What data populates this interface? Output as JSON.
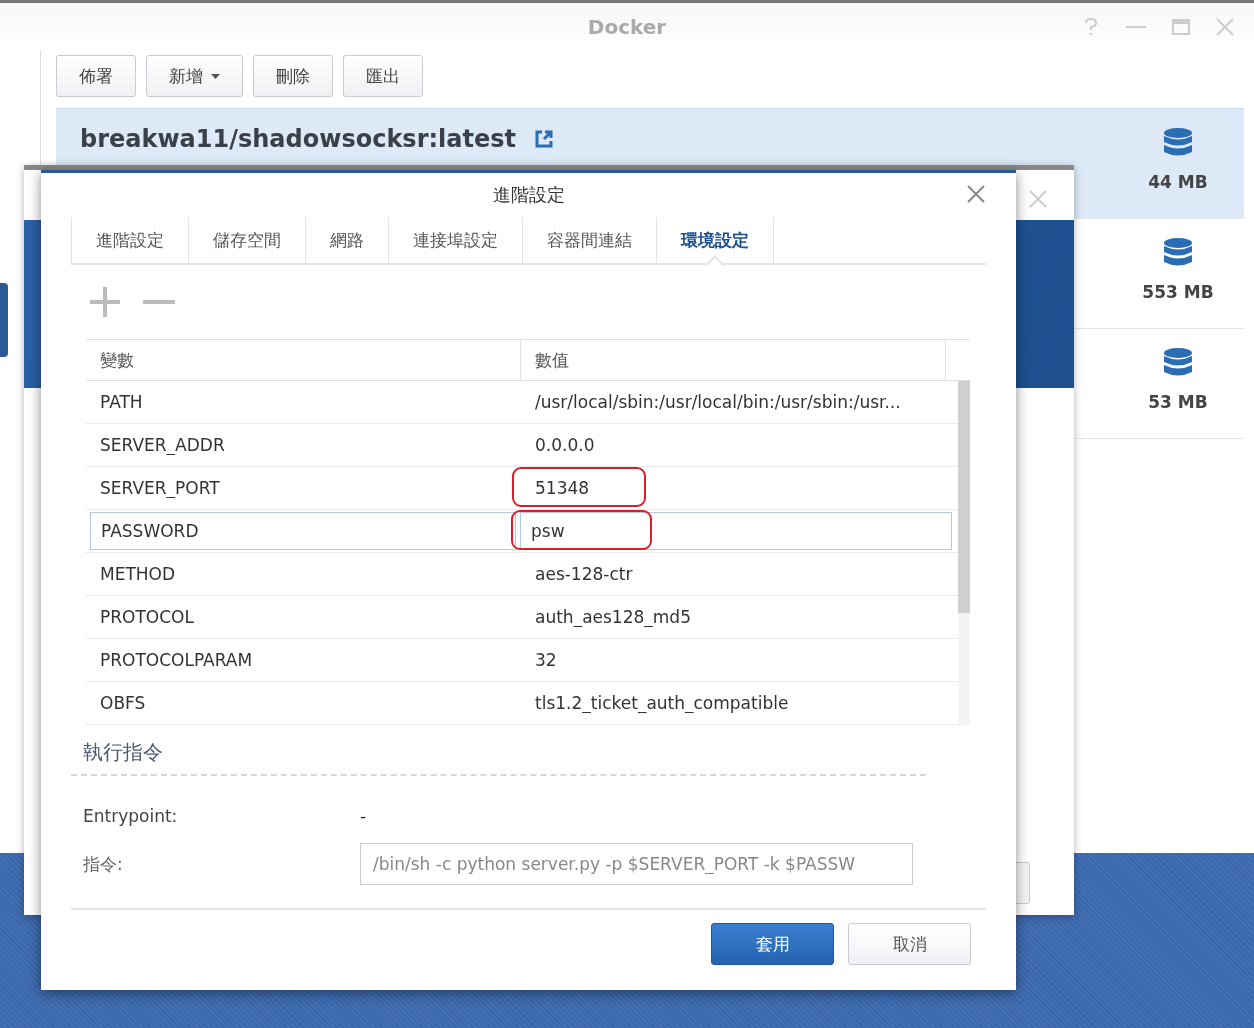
{
  "background_window": {
    "title": "Docker",
    "toolbar": [
      {
        "label": "佈署",
        "kind": "button"
      },
      {
        "label": "新增",
        "kind": "dropdown"
      },
      {
        "label": "刪除",
        "kind": "button"
      },
      {
        "label": "匯出",
        "kind": "button"
      }
    ],
    "images": [
      {
        "name": "breakwa11/shadowsocksr:latest",
        "size": "44 MB",
        "selected": true
      },
      {
        "size": "553 MB",
        "selected": false
      },
      {
        "size": "53 MB",
        "selected": false
      }
    ]
  },
  "dialog": {
    "title": "進階設定",
    "tabs": [
      {
        "label": "進階設定",
        "selected": false
      },
      {
        "label": "儲存空間",
        "selected": false
      },
      {
        "label": "網路",
        "selected": false
      },
      {
        "label": "連接埠設定",
        "selected": false
      },
      {
        "label": "容器間連結",
        "selected": false
      },
      {
        "label": "環境設定",
        "selected": true
      }
    ],
    "table": {
      "columns": [
        "變數",
        "數值"
      ],
      "rows": [
        {
          "cells": [
            "PATH",
            "/usr/local/sbin:/usr/local/bin:/usr/sbin:/usr..."
          ],
          "editing": false
        },
        {
          "cells": [
            "SERVER_ADDR",
            "0.0.0.0"
          ],
          "editing": false
        },
        {
          "cells": [
            "SERVER_PORT",
            "51348"
          ],
          "editing": false,
          "highlighted": true
        },
        {
          "cells": [
            "PASSWORD",
            "psw"
          ],
          "editing": true,
          "highlighted": true
        },
        {
          "cells": [
            "METHOD",
            "aes-128-ctr"
          ],
          "editing": false
        },
        {
          "cells": [
            "PROTOCOL",
            "auth_aes128_md5"
          ],
          "editing": false
        },
        {
          "cells": [
            "PROTOCOLPARAM",
            "32"
          ],
          "editing": false
        },
        {
          "cells": [
            "OBFS",
            "tls1.2_ticket_auth_compatible"
          ],
          "editing": false
        }
      ]
    },
    "command_section": {
      "title": "執行指令",
      "fields": [
        {
          "label": "Entrypoint:",
          "value": "-",
          "kind": "text"
        },
        {
          "label": "指令:",
          "value": "/bin/sh -c python server.py -p $SERVER_PORT -k $PASSW",
          "kind": "input"
        }
      ]
    },
    "buttons": [
      {
        "label": "套用",
        "primary": true
      },
      {
        "label": "取消",
        "primary": false
      }
    ]
  }
}
